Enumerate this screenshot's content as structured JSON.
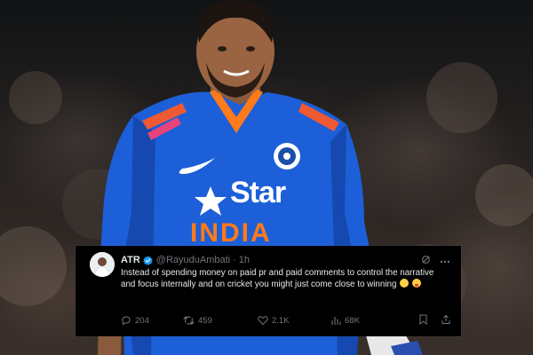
{
  "tweet": {
    "author_name": "ATR",
    "handle": "@RayuduAmbati",
    "separator": "·",
    "time": "1h",
    "text": "Instead of spending money on paid pr and paid comments to control the narrative and focus internally and on cricket you might just come close to winning",
    "emojis": [
      "rolling-on-floor-laughing",
      "face-with-tongue"
    ],
    "verified": true,
    "stats": {
      "replies": "204",
      "reposts": "459",
      "likes": "2.1K",
      "views": "68K"
    }
  },
  "photo": {
    "jersey_brand": "Star",
    "jersey_team": "INDIA"
  },
  "colors": {
    "jersey_blue": "#1c5fd8",
    "tweet_bg": "#000000",
    "verified_blue": "#1d9bf0",
    "muted_text": "#71767b"
  }
}
